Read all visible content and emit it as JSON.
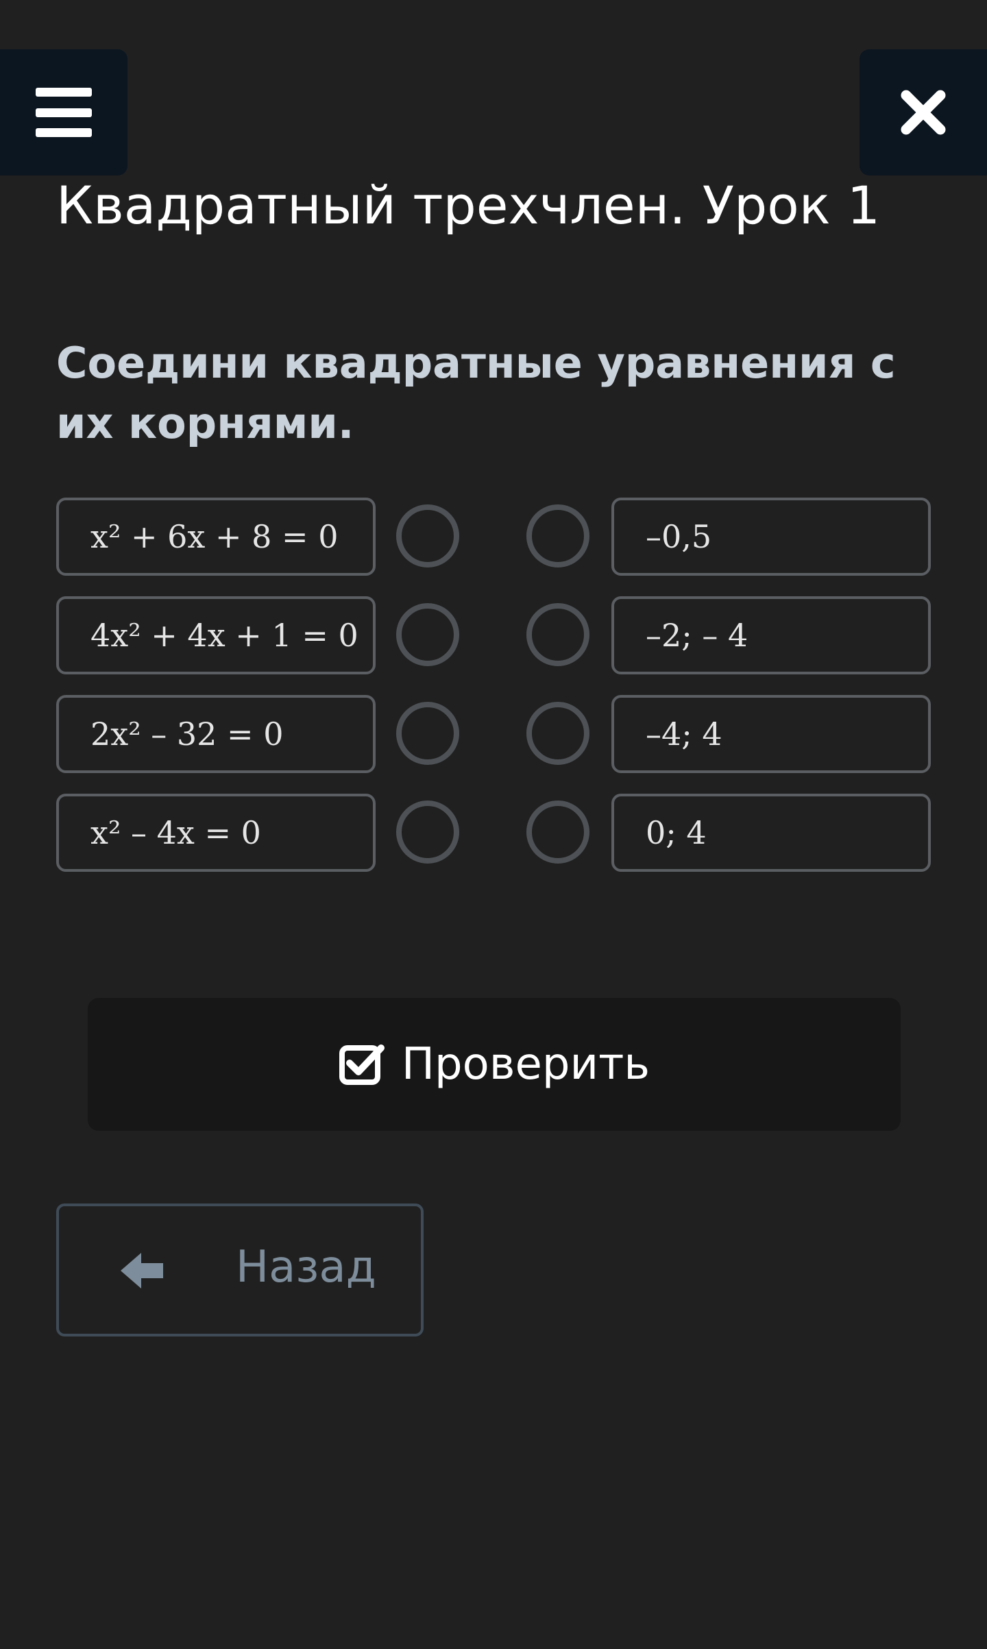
{
  "header": {
    "menu_icon": "hamburger-menu-icon",
    "close_icon": "close-x-icon"
  },
  "lesson": {
    "title": "Квадратный трехчлен. Урок 1",
    "instruction": "Соедини квадратные уравнения с их корнями."
  },
  "equations": [
    "x² + 6x + 8 = 0",
    "4x² + 4x + 1 = 0",
    "2x² – 32 = 0",
    "x² – 4x = 0"
  ],
  "roots": [
    "–0,5",
    "–2; – 4",
    "–4; 4",
    "0; 4"
  ],
  "buttons": {
    "check_label": "Проверить",
    "check_icon": "checkbox-checked-icon",
    "back_label": "Назад",
    "back_icon": "arrow-left-icon"
  },
  "colors": {
    "background": "#202020",
    "header_button": "#0c1620",
    "instruction": "#c9d1da",
    "box_border": "#5b5e62",
    "back_text": "#7e8d9b"
  }
}
